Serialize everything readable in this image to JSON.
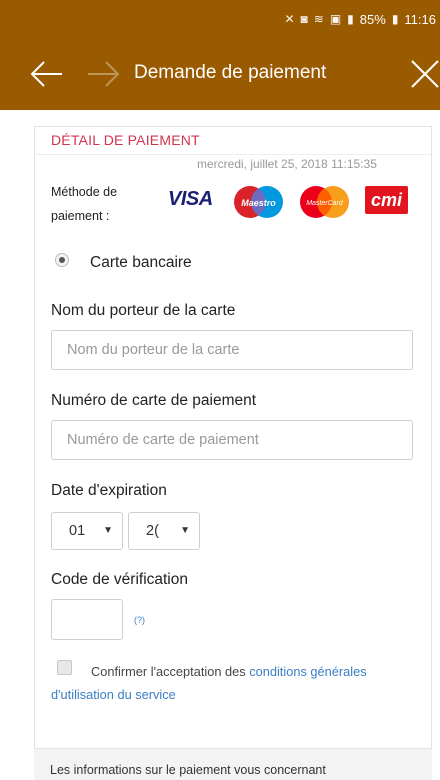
{
  "status_bar": {
    "battery": "85%",
    "time": "11:16",
    "icons": [
      "mute-icon",
      "screenshot-icon",
      "wifi-icon",
      "gallery-icon",
      "signal-icon",
      "battery-icon"
    ]
  },
  "app_bar": {
    "title": "Demande de paiement",
    "background_color": "#9a5a00",
    "icons": [
      "arrow-left-icon",
      "arrow-right-icon",
      "close-icon"
    ]
  },
  "card": {
    "header": "DÉTAIL DE PAIEMENT",
    "header_color": "#d0344f",
    "datetime": "mercredi, juillet 25, 2018 11:15:35",
    "method_label_line1": "Méthode de",
    "method_label_line2": "paiement :",
    "logos": {
      "visa": "VISA",
      "maestro": "Maestro",
      "mastercard": "MasterCard",
      "cmi": "cmi"
    },
    "payment_type": "Carte bancaire",
    "cardholder": {
      "label": "Nom du porteur de la carte",
      "placeholder": "Nom du porteur de la carte"
    },
    "card_number": {
      "label": "Numéro de carte de paiement",
      "placeholder": "Numéro de carte de paiement"
    },
    "expiration": {
      "label": "Date d'expiration",
      "month": "01",
      "year": "2("
    },
    "verification": {
      "label": "Code de vérification",
      "help": "(?)"
    },
    "terms": {
      "prefix": "Confirmer l'acceptation des ",
      "link": "conditions générales d'utilisation du service"
    },
    "link_color": "#3a7fc6"
  },
  "info": {
    "text": "Les informations sur le paiement vous concernant"
  }
}
